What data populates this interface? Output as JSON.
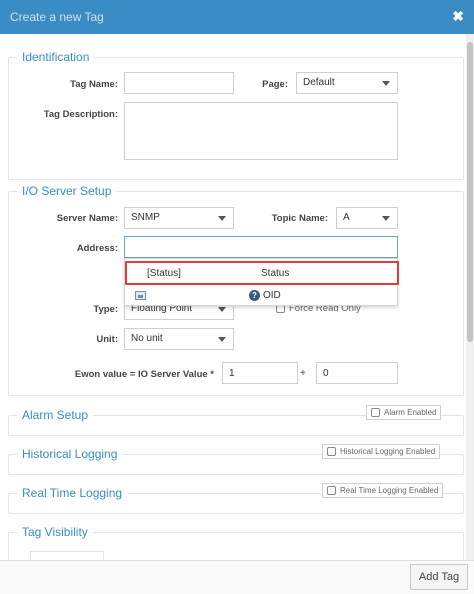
{
  "window": {
    "title": "Create a new Tag"
  },
  "identification": {
    "legend": "Identification",
    "tag_name_label": "Tag Name:",
    "tag_name_value": "",
    "page_label": "Page:",
    "page_value": "Default",
    "description_label": "Tag Description:",
    "description_value": ""
  },
  "io_server": {
    "legend": "I/O Server Setup",
    "server_name_label": "Server Name:",
    "server_name_value": "SNMP",
    "topic_name_label": "Topic Name:",
    "topic_name_value": "A",
    "address_label": "Address:",
    "address_value": "",
    "type_label": "Type:",
    "type_value": "Floating Point",
    "force_read_only_label": "Force Read Only",
    "unit_label": "Unit:",
    "unit_value": "No unit",
    "ewon_value_label": "Ewon value = IO Server Value *",
    "multiplier_value": "1",
    "plus_sign": "+",
    "offset_value": "0"
  },
  "address_dropdown": {
    "items": [
      {
        "name": "[Status]",
        "description": "Status"
      }
    ],
    "footer_label": "OID",
    "icons": [
      "image-icon",
      "help-icon"
    ]
  },
  "alarm_setup": {
    "legend": "Alarm Setup",
    "checkbox_label": "Alarm Enabled",
    "checked": false
  },
  "historical_logging": {
    "legend": "Historical Logging",
    "checkbox_label": "Historical Logging Enabled",
    "checked": false
  },
  "real_time_logging": {
    "legend": "Real Time Logging",
    "checkbox_label": "Real Time Logging Enabled",
    "checked": false
  },
  "tag_visibility": {
    "legend": "Tag Visibility"
  },
  "footer": {
    "add_button_label": "Add Tag"
  },
  "colors": {
    "title_bar": "#3a8cc4",
    "legend_text": "#3a8cc4",
    "highlight_border": "#e03c3c"
  }
}
